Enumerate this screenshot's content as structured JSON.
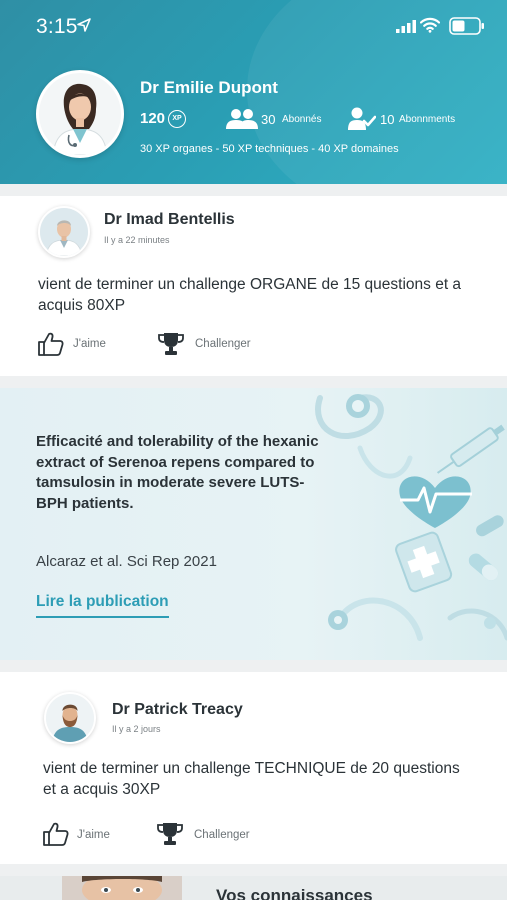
{
  "status_bar": {
    "time": "3:15"
  },
  "profile": {
    "name": "Dr Emilie Dupont",
    "xp": "120",
    "xp_badge": "XP",
    "followers_count": "30",
    "followers_label": "Abonnés",
    "following_count": "10",
    "following_label": "Abonnments",
    "xp_breakdown": "30 XP organes - 50 XP techniques - 40 XP domaines"
  },
  "feed": [
    {
      "name": "Dr Imad Bentellis",
      "time": "Il y a 22 minutes",
      "text": "vient de terminer un challenge ORGANE de 15 questions et a acquis 80XP",
      "like_label": "J'aime",
      "challenge_label": "Challenger"
    },
    {
      "name": "Dr Patrick Treacy",
      "time": "Il y a 2 jours",
      "text": "vient de terminer un challenge TECHNIQUE de 20 questions et a acquis 30XP",
      "like_label": "J'aime",
      "challenge_label": "Challenger"
    }
  ],
  "publication": {
    "title": "Efficacité and tolerability of the hexanic extract of Serenoa repens compared to tamsulosin in moderate severe LUTS-BPH patients.",
    "citation": "Alcaraz et al. Sci Rep 2021",
    "link_label": "Lire la publication"
  },
  "next_card": {
    "title": "Vos connaissances"
  },
  "colors": {
    "accent": "#2d9db5",
    "header_start": "#2f8fa5",
    "header_end": "#2fb0c4"
  }
}
